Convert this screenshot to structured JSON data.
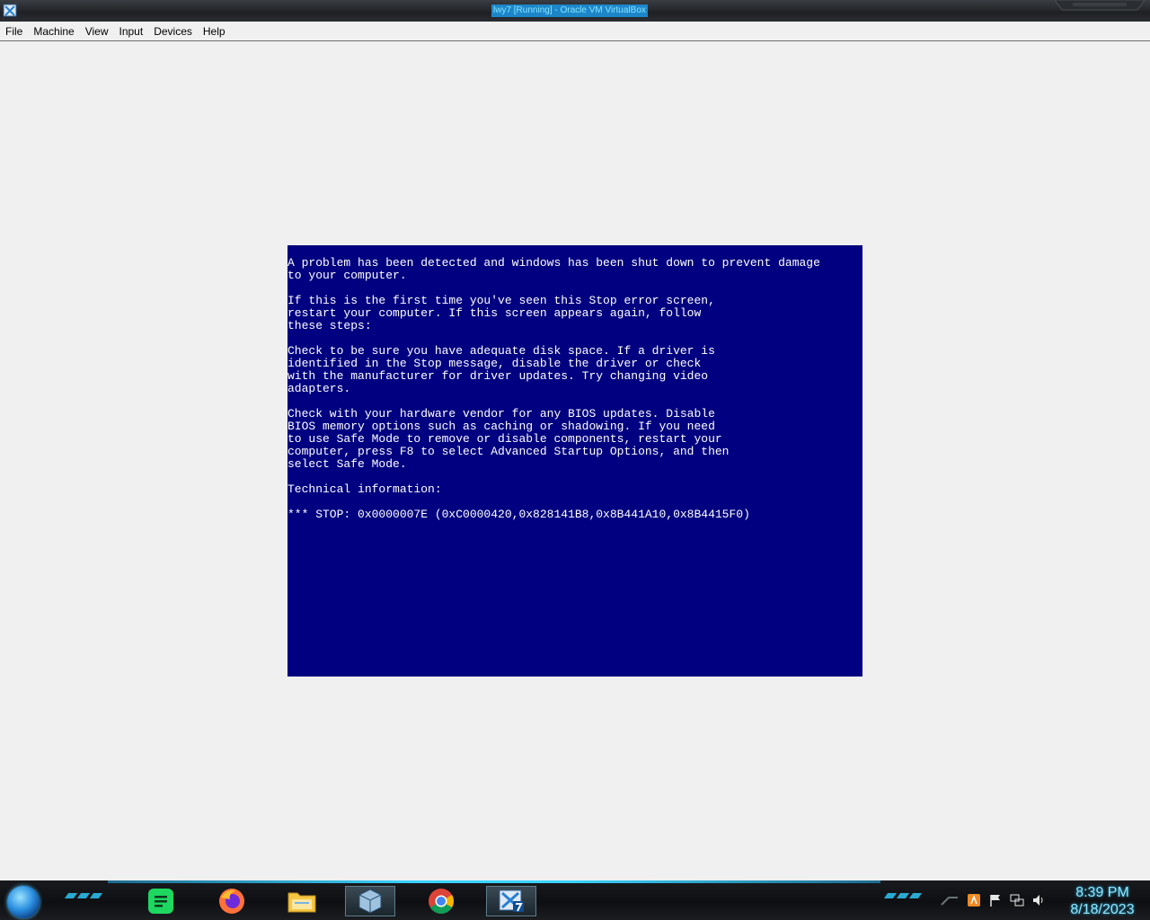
{
  "window": {
    "title": "lwy7 [Running] - Oracle VM VirtualBox",
    "icon": "virtualbox-icon"
  },
  "menubar": {
    "items": [
      "File",
      "Machine",
      "View",
      "Input",
      "Devices",
      "Help"
    ]
  },
  "bsod": {
    "paragraphs": [
      "A problem has been detected and windows has been shut down to prevent damage\nto your computer.",
      "If this is the first time you've seen this Stop error screen,\nrestart your computer. If this screen appears again, follow\nthese steps:",
      "Check to be sure you have adequate disk space. If a driver is\nidentified in the Stop message, disable the driver or check\nwith the manufacturer for driver updates. Try changing video\nadapters.",
      "Check with your hardware vendor for any BIOS updates. Disable\nBIOS memory options such as caching or shadowing. If you need\nto use Safe Mode to remove or disable components, restart your\ncomputer, press F8 to select Advanced Startup Options, and then\nselect Safe Mode.",
      "Technical information:",
      "*** STOP: 0x0000007E (0xC0000420,0x828141B8,0x8B441A10,0x8B4415F0)"
    ],
    "background_color": "#000080",
    "text_color": "#ffffff"
  },
  "taskbar": {
    "pinned": [
      {
        "name": "chat-app-icon",
        "color": "#1ed760"
      },
      {
        "name": "firefox-icon",
        "color": "#ff7139"
      },
      {
        "name": "file-explorer-icon",
        "color": "#f5c542"
      },
      {
        "name": "virtualbox-manager-icon",
        "color": "#9fc3df"
      },
      {
        "name": "chrome-icon",
        "color": "#4285f4"
      },
      {
        "name": "virtualbox-vm-icon",
        "color": "#2a7fd4"
      }
    ],
    "tray_icons": [
      "show-hidden-icon",
      "security-icon",
      "flag-icon",
      "network-icon",
      "volume-icon"
    ],
    "clock": {
      "time": "8:39 PM",
      "date": "8/18/2023"
    }
  },
  "colors": {
    "accent": "#2ed0ff",
    "taskbar": "#0e0f12",
    "vm_background": "#f0f0f0"
  }
}
